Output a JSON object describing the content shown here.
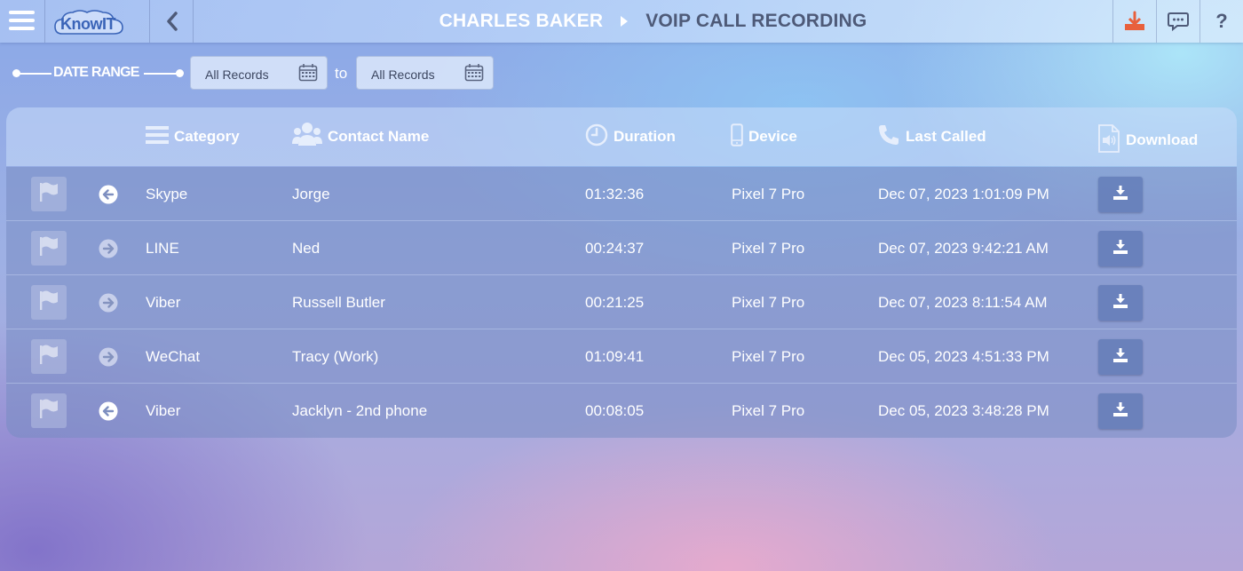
{
  "header": {
    "logo_text": "KnowIT",
    "user_name": "CHARLES BAKER",
    "page_title": "VOIP CALL RECORDING"
  },
  "date_range": {
    "label": "DATE RANGE",
    "from_value": "All Records",
    "to_label": "to",
    "to_value": "All Records"
  },
  "table": {
    "columns": {
      "category": "Category",
      "contact": "Contact Name",
      "duration": "Duration",
      "device": "Device",
      "last_called": "Last Called",
      "download": "Download"
    },
    "rows": [
      {
        "direction": "incoming",
        "category": "Skype",
        "contact": "Jorge",
        "duration": "01:32:36",
        "device": "Pixel 7 Pro",
        "last_called": "Dec 07, 2023 1:01:09 PM"
      },
      {
        "direction": "outgoing",
        "category": "LINE",
        "contact": "Ned",
        "duration": "00:24:37",
        "device": "Pixel 7 Pro",
        "last_called": "Dec 07, 2023 9:42:21 AM"
      },
      {
        "direction": "outgoing",
        "category": "Viber",
        "contact": "Russell Butler",
        "duration": "00:21:25",
        "device": "Pixel 7 Pro",
        "last_called": "Dec 07, 2023 8:11:54 AM"
      },
      {
        "direction": "outgoing",
        "category": "WeChat",
        "contact": "Tracy (Work)",
        "duration": "01:09:41",
        "device": "Pixel 7 Pro",
        "last_called": "Dec 05, 2023 4:51:33 PM"
      },
      {
        "direction": "incoming",
        "category": "Viber",
        "contact": "Jacklyn - 2nd phone",
        "duration": "00:08:05",
        "device": "Pixel 7 Pro",
        "last_called": "Dec 05, 2023 3:48:28 PM"
      }
    ]
  },
  "colors": {
    "accent_download": "#e8603c",
    "title_secondary": "#4e5a78"
  }
}
